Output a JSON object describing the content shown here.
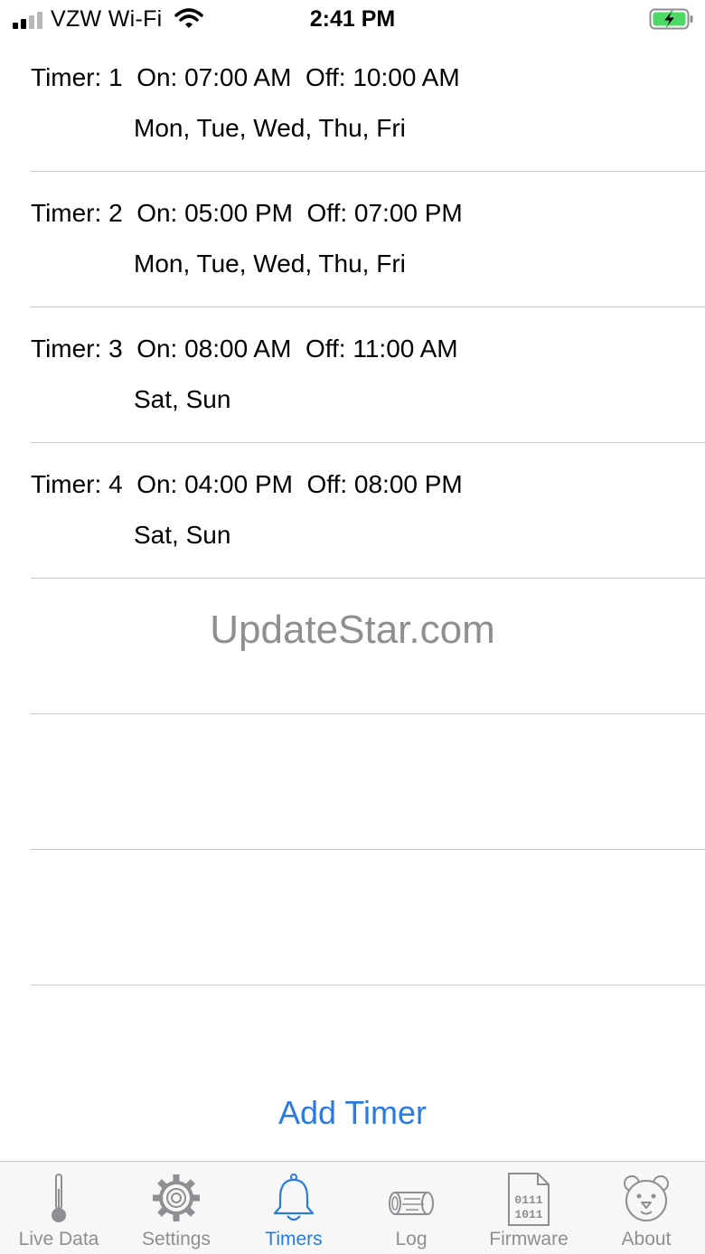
{
  "status_bar": {
    "carrier": "VZW Wi-Fi",
    "time": "2:41 PM",
    "battery_icon": "battery-charging-icon",
    "battery_color": "#4cd964"
  },
  "timers": [
    {
      "line1": "Timer: 1  On: 07:00 AM  Off: 10:00 AM",
      "days": "Mon, Tue, Wed, Thu, Fri"
    },
    {
      "line1": "Timer: 2  On: 05:00 PM  Off: 07:00 PM",
      "days": "Mon, Tue, Wed, Thu, Fri"
    },
    {
      "line1": "Timer: 3  On: 08:00 AM  Off: 11:00 AM",
      "days": "Sat, Sun"
    },
    {
      "line1": "Timer: 4  On: 04:00 PM  Off: 08:00 PM",
      "days": "Sat, Sun"
    }
  ],
  "watermark": "UpdateStar.com",
  "add_timer_label": "Add Timer",
  "accent_color": "#2a7be0",
  "tabs": [
    {
      "label": "Live Data",
      "icon": "thermometer-icon"
    },
    {
      "label": "Settings",
      "icon": "gear-icon"
    },
    {
      "label": "Timers",
      "icon": "bell-icon",
      "active": true
    },
    {
      "label": "Log",
      "icon": "log-icon"
    },
    {
      "label": "Firmware",
      "icon": "binary-file-icon"
    },
    {
      "label": "About",
      "icon": "bear-icon"
    }
  ]
}
